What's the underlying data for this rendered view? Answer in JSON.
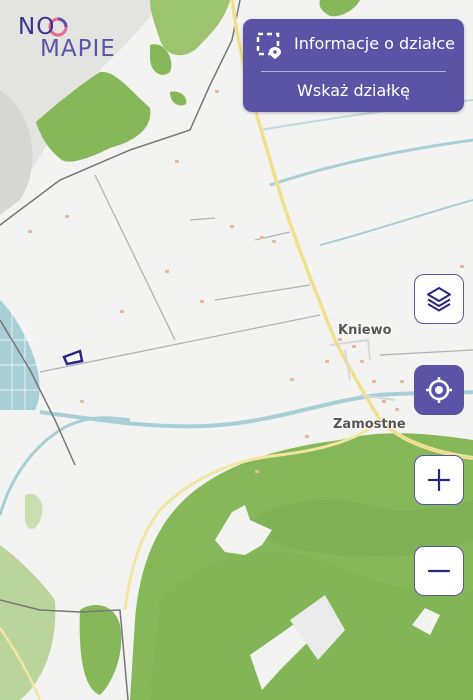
{
  "logo": {
    "text_top": "NO",
    "text_bottom": "MAPIE"
  },
  "panel": {
    "info_label": "Informacje o działce",
    "point_label": "Wskaż działkę"
  },
  "map": {
    "places": [
      "Kniewo",
      "Zamostne"
    ]
  },
  "controls": {
    "layers_icon": "layers-icon",
    "locate_icon": "locate-icon",
    "zoom_in_icon": "plus-icon",
    "zoom_out_icon": "minus-icon"
  },
  "colors": {
    "accent": "#5b54a6",
    "forest": "#86b85a",
    "water": "#a9cfd6"
  }
}
